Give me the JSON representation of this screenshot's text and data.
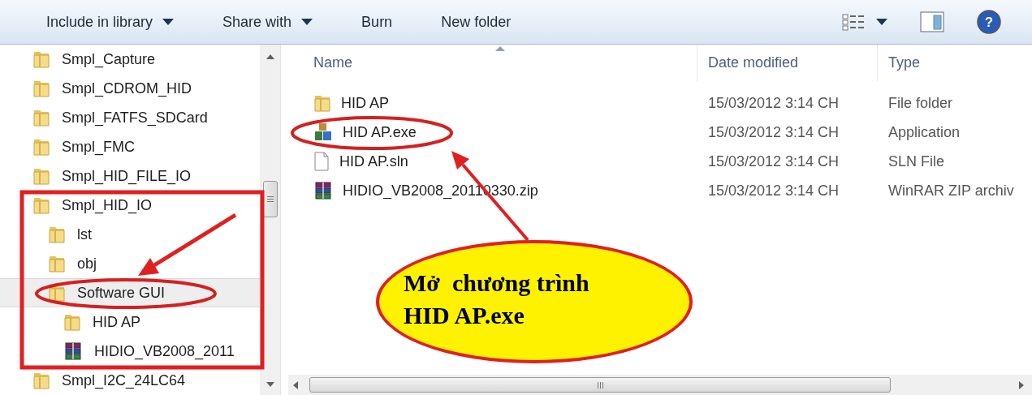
{
  "toolbar": {
    "buttons": [
      {
        "label": "Include in library",
        "dropdown": true
      },
      {
        "label": "Share with",
        "dropdown": true
      },
      {
        "label": "Burn",
        "dropdown": false
      },
      {
        "label": "New folder",
        "dropdown": false
      }
    ],
    "help_glyph": "?"
  },
  "navigation": {
    "items": [
      {
        "label": "Smpl_Capture",
        "kind": "folder",
        "selected": false
      },
      {
        "label": "Smpl_CDROM_HID",
        "kind": "folder",
        "selected": false
      },
      {
        "label": "Smpl_FATFS_SDCard",
        "kind": "folder",
        "selected": false
      },
      {
        "label": "Smpl_FMC",
        "kind": "folder",
        "selected": false
      },
      {
        "label": "Smpl_HID_FILE_IO",
        "kind": "folder",
        "selected": false
      },
      {
        "label": "Smpl_HID_IO",
        "kind": "folder",
        "selected": false,
        "children": [
          {
            "label": "lst",
            "kind": "folder",
            "selected": false
          },
          {
            "label": "obj",
            "kind": "folder",
            "selected": false
          },
          {
            "label": "Software GUI",
            "kind": "folder",
            "selected": true,
            "children": [
              {
                "label": "HID AP",
                "kind": "folder",
                "selected": false
              },
              {
                "label": "HIDIO_VB2008_2011",
                "kind": "archive",
                "selected": false
              }
            ]
          }
        ]
      },
      {
        "label": "Smpl_I2C_24LC64",
        "kind": "folder",
        "selected": false
      }
    ]
  },
  "file_list": {
    "columns": [
      "Name",
      "Date modified",
      "Type"
    ],
    "rows": [
      {
        "name": "HID AP",
        "date": "15/03/2012 3:14 CH",
        "type": "File folder",
        "kind": "folder"
      },
      {
        "name": "HID AP.exe",
        "date": "15/03/2012 3:14 CH",
        "type": "Application",
        "kind": "exe"
      },
      {
        "name": "HID AP.sln",
        "date": "15/03/2012 3:14 CH",
        "type": "SLN File",
        "kind": "file"
      },
      {
        "name": "HIDIO_VB2008_20110330.zip",
        "date": "15/03/2012 3:14 CH",
        "type": "WinRAR ZIP archiv",
        "kind": "archive"
      }
    ]
  },
  "callout": {
    "lines": [
      "Mở  chương trình",
      "HID AP.exe"
    ]
  }
}
